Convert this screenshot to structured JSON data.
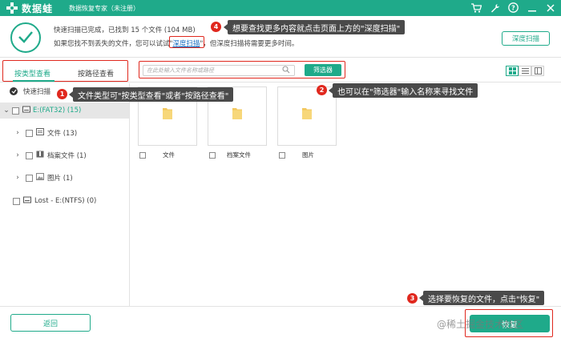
{
  "titlebar": {
    "app_name": "数据蛙",
    "app_subtitle": "数据恢复专家（未注册）",
    "icons": [
      "cart-icon",
      "wrench-icon",
      "help-icon",
      "minimize-icon",
      "close-icon"
    ]
  },
  "header": {
    "scan_status": "快速扫描已完成，已找到 15 个文件 (104 MB)",
    "hint_prefix": "如果您找不到丢失的文件，您可以试试\"",
    "hint_link": "深度扫描",
    "hint_suffix": "\"，但深度扫描将需要更多时间。",
    "deep_scan_button": "深度扫描"
  },
  "toolbar": {
    "tab_by_type": "按类型查看",
    "tab_by_path": "按路径查看",
    "search_placeholder": "在此处输入文件名称或路径",
    "filter_button": "筛选器"
  },
  "sidebar": {
    "quick_scan": "快速扫描",
    "drive_e": "E:(FAT32) (15)",
    "items": [
      {
        "label": "文件 (13)",
        "icon": "folder-icon"
      },
      {
        "label": "档案文件 (1)",
        "icon": "archive-icon"
      },
      {
        "label": "图片 (1)",
        "icon": "image-icon"
      }
    ],
    "lost_drive": "Lost - E:(NTFS) (0)"
  },
  "content": {
    "cards": [
      {
        "label": "文件"
      },
      {
        "label": "档案文件"
      },
      {
        "label": "图片"
      }
    ]
  },
  "annotations": {
    "a1": {
      "num": "1",
      "text": "文件类型可\"按类型查看\"或者\"按路径查看\""
    },
    "a2": {
      "num": "2",
      "text": "也可以在\"筛选器\"输入名称来寻找文件"
    },
    "a3": {
      "num": "3",
      "text": "选择要恢复的文件，点击\"恢复\""
    },
    "a4": {
      "num": "4",
      "text": "想要查找更多内容就点击页面上方的\"深度扫描\""
    }
  },
  "footer": {
    "back_button": "返回",
    "recover_button": "恢复",
    "watermark": "@稀土掘金技术社区"
  },
  "colors": {
    "brand": "#1faa8a",
    "annotation_red": "#e0281e",
    "tooltip_bg": "#4a4a4a"
  }
}
